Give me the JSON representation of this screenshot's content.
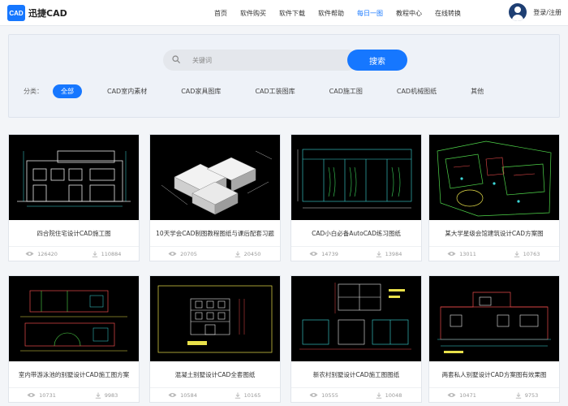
{
  "brand": {
    "mark": "CAD",
    "name": "迅捷CAD"
  },
  "nav": [
    {
      "label": "首页",
      "active": false
    },
    {
      "label": "软件购买",
      "active": false
    },
    {
      "label": "软件下载",
      "active": false
    },
    {
      "label": "软件帮助",
      "active": false
    },
    {
      "label": "每日一图",
      "active": true
    },
    {
      "label": "教程中心",
      "active": false
    },
    {
      "label": "在线转换",
      "active": false
    }
  ],
  "user": {
    "login_label": "登录/注册"
  },
  "search": {
    "placeholder": "关键词",
    "button_label": "搜索"
  },
  "categories": {
    "label": "分类：",
    "items": [
      "全部",
      "CAD室内素材",
      "CAD家具图库",
      "CAD工装图库",
      "CAD施工图",
      "CAD机械图纸",
      "其他"
    ],
    "active_index": 0
  },
  "cards": [
    {
      "title": "四合院住宅设计CAD施工图",
      "views": "126420",
      "downloads": "110884",
      "thumb": "house-elevation"
    },
    {
      "title": "10天学会CAD制图教程图纸与课后配套习题",
      "views": "20705",
      "downloads": "20450",
      "thumb": "3d-blocks"
    },
    {
      "title": "CAD小白必备AutoCAD练习图纸",
      "views": "14739",
      "downloads": "13984",
      "thumb": "cabinet-elevation"
    },
    {
      "title": "某大学星级会馆建筑设计CAD方案图",
      "views": "13011",
      "downloads": "10763",
      "thumb": "site-plan"
    },
    {
      "title": "室内带游泳池的别墅设计CAD施工图方案",
      "views": "10731",
      "downloads": "9983",
      "thumb": "villa-section"
    },
    {
      "title": "混凝土别墅设计CAD全套图纸",
      "views": "10584",
      "downloads": "10165",
      "thumb": "concrete-villa"
    },
    {
      "title": "新农村别墅设计CAD施工图图纸",
      "views": "10555",
      "downloads": "10048",
      "thumb": "rural-villa"
    },
    {
      "title": "两套私人别墅设计CAD方案图有效果图",
      "views": "10471",
      "downloads": "9753",
      "thumb": "private-villa"
    }
  ],
  "colors": {
    "accent": "#1677ff",
    "thumb_bg": "#000000"
  }
}
